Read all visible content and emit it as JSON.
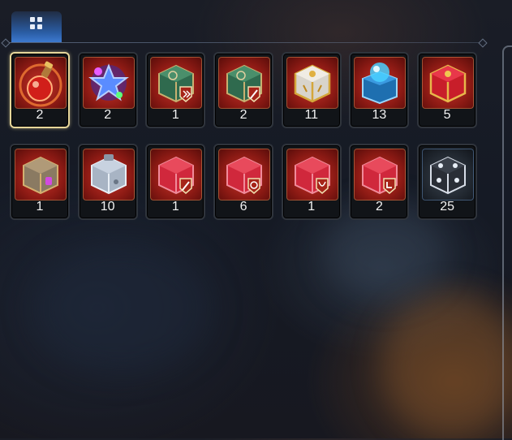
{
  "toolbar": {
    "filter_icon": "grid-icon"
  },
  "colors": {
    "selected_border": "#e6d69a",
    "tab_active": "#2b5ea6",
    "slot_red": "#a82219"
  },
  "inventory": {
    "items": [
      {
        "icon": "red-potion-icon",
        "count": "2"
      },
      {
        "icon": "star-potion-icon",
        "count": "2"
      },
      {
        "icon": "green-chest-arrow-icon",
        "count": "1"
      },
      {
        "icon": "green-chest-sword-icon",
        "count": "2"
      },
      {
        "icon": "white-gold-chest-icon",
        "count": "11"
      },
      {
        "icon": "blue-orb-chest-icon",
        "count": "13"
      },
      {
        "icon": "red-gold-chest-icon",
        "count": "5"
      },
      {
        "icon": "purple-gem-chest-icon",
        "count": "1"
      },
      {
        "icon": "silver-chest-icon",
        "count": "10"
      },
      {
        "icon": "red-chest-sword-icon",
        "count": "1"
      },
      {
        "icon": "red-chest-target-icon",
        "count": "6"
      },
      {
        "icon": "red-chest-horns-icon",
        "count": "1"
      },
      {
        "icon": "red-chest-boot-icon",
        "count": "2"
      },
      {
        "icon": "dark-silver-chest-icon",
        "count": "25"
      }
    ]
  }
}
